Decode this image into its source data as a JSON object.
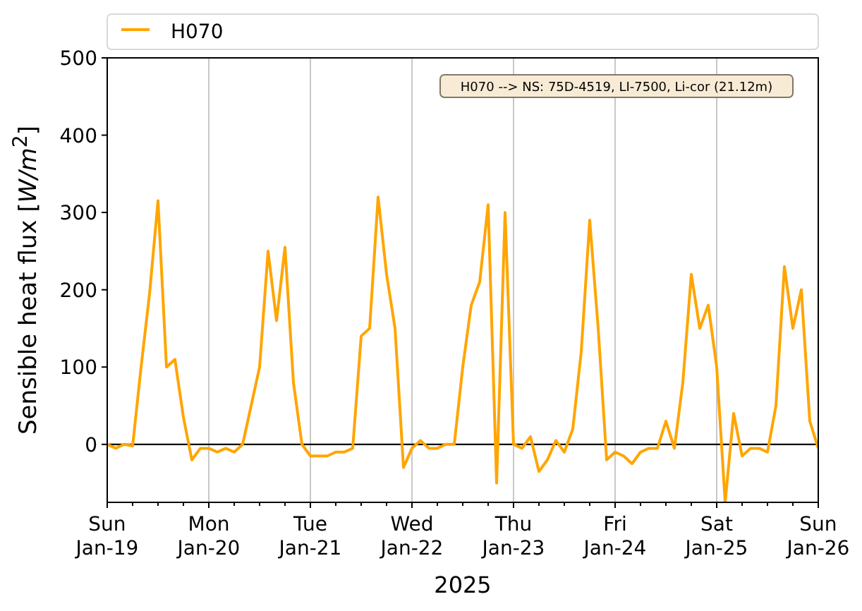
{
  "chart_data": {
    "type": "line",
    "xlabel": "2025",
    "ylabel": "Sensible heat flux [*W/m*$^{2}$]",
    "categories": [
      "Sun Jan-19",
      null,
      null,
      null,
      null,
      null,
      null,
      null,
      null,
      null,
      null,
      null,
      "Mon Jan-20",
      null,
      null,
      null,
      null,
      null,
      null,
      null,
      null,
      null,
      null,
      null,
      "Tue Jan-21",
      null,
      null,
      null,
      null,
      null,
      null,
      null,
      null,
      null,
      null,
      null,
      "Wed Jan-22",
      null,
      null,
      null,
      null,
      null,
      null,
      null,
      null,
      null,
      null,
      null,
      "Thu Jan-23",
      null,
      null,
      null,
      null,
      null,
      null,
      null,
      null,
      null,
      null,
      null,
      "Fri Jan-24",
      null,
      null,
      null,
      null,
      null,
      null,
      null,
      null,
      null,
      null,
      null,
      "Sat Jan-25",
      null,
      null,
      null,
      null,
      null,
      null,
      null,
      null,
      null,
      null,
      null,
      "Sun Jan-26"
    ],
    "series": [
      {
        "name": "H070",
        "color": "#ffa500",
        "values": [
          0,
          -5,
          0,
          -2,
          100,
          195,
          315,
          100,
          110,
          35,
          -20,
          -5,
          -5,
          -10,
          -5,
          -10,
          0,
          50,
          100,
          250,
          160,
          255,
          80,
          0,
          -15,
          -15,
          -15,
          -10,
          -10,
          -5,
          140,
          150,
          320,
          220,
          150,
          -30,
          -5,
          5,
          -5,
          -5,
          0,
          0,
          100,
          180,
          210,
          310,
          -50,
          300,
          0,
          -5,
          10,
          -35,
          -20,
          5,
          -10,
          20,
          120,
          290,
          150,
          -20,
          -10,
          -15,
          -25,
          -10,
          -5,
          -5,
          30,
          -5,
          80,
          220,
          150,
          180,
          100,
          -75,
          40,
          -15,
          -5,
          -5,
          -10,
          50,
          230,
          150,
          200,
          30,
          -5
        ]
      }
    ],
    "ylim": [
      -75,
      500
    ],
    "grid": "x",
    "yticks": [
      0,
      100,
      200,
      300,
      400,
      500
    ],
    "annotations": [
      "H070 --> NS: 75D-4519, LI-7500, Li-cor (21.12m)"
    ]
  }
}
